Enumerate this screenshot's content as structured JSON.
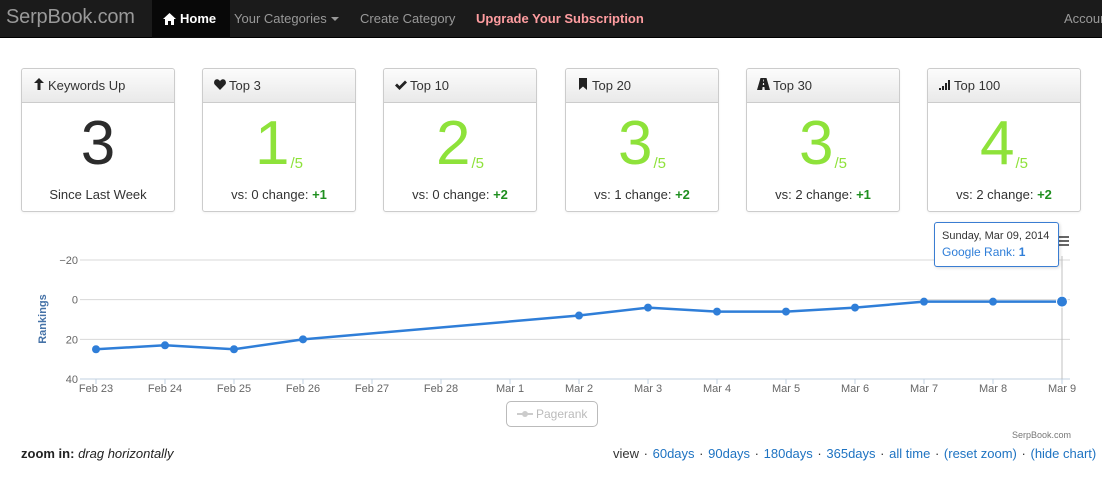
{
  "nav": {
    "brand": "SerpBook.com",
    "home": "Home",
    "categories": "Your Categories",
    "create": "Create Category",
    "upgrade": "Upgrade Your Subscription",
    "account": "Account"
  },
  "cards": [
    {
      "title": "Keywords Up",
      "icon": "arrow-up-icon",
      "value": "3",
      "denominator": "",
      "foot_text": "Since Last Week",
      "foot_change": ""
    },
    {
      "title": "Top 3",
      "icon": "heart-icon",
      "value": "1",
      "denominator": "/5",
      "foot_text": "vs: 0 change: ",
      "foot_change": "+1"
    },
    {
      "title": "Top 10",
      "icon": "check-icon",
      "value": "2",
      "denominator": "/5",
      "foot_text": "vs: 0 change: ",
      "foot_change": "+2"
    },
    {
      "title": "Top 20",
      "icon": "bookmark-icon",
      "value": "3",
      "denominator": "/5",
      "foot_text": "vs: 1 change: ",
      "foot_change": "+2"
    },
    {
      "title": "Top 30",
      "icon": "road-icon",
      "value": "3",
      "denominator": "/5",
      "foot_text": "vs: 2 change: ",
      "foot_change": "+1"
    },
    {
      "title": "Top 100",
      "icon": "signal-icon",
      "value": "4",
      "denominator": "/5",
      "foot_text": "vs: 2 change: ",
      "foot_change": "+2"
    }
  ],
  "chart_data": {
    "type": "line",
    "ylabel": "Rankings",
    "y_reversed": true,
    "ylim": [
      -20,
      40
    ],
    "yticks": [
      -20,
      0,
      20,
      40
    ],
    "categories": [
      "Feb 23",
      "Feb 24",
      "Feb 25",
      "Feb 26",
      "Feb 27",
      "Feb 28",
      "Mar 1",
      "Mar 2",
      "Mar 3",
      "Mar 4",
      "Mar 5",
      "Mar 6",
      "Mar 7",
      "Mar 8",
      "Mar 9"
    ],
    "series": [
      {
        "name": "Google Rank",
        "color": "#2f7ed8",
        "points": [
          {
            "x": "Feb 23",
            "y": 25
          },
          {
            "x": "Feb 24",
            "y": 23
          },
          {
            "x": "Feb 25",
            "y": 25
          },
          {
            "x": "Feb 26",
            "y": 20
          },
          {
            "x": "Mar 2",
            "y": 8
          },
          {
            "x": "Mar 3",
            "y": 4
          },
          {
            "x": "Mar 4",
            "y": 6
          },
          {
            "x": "Mar 5",
            "y": 6
          },
          {
            "x": "Mar 6",
            "y": 4
          },
          {
            "x": "Mar 7",
            "y": 1
          },
          {
            "x": "Mar 8",
            "y": 1
          },
          {
            "x": "Mar 9",
            "y": 1
          }
        ]
      },
      {
        "name": "Pagerank",
        "color": "#cccccc",
        "hidden": true,
        "points": []
      }
    ],
    "tooltip": {
      "date": "Sunday, Mar 09, 2014",
      "label": "Google Rank: ",
      "value": "1"
    },
    "credit": "SerpBook.com"
  },
  "footer": {
    "zoom_label": "zoom in:",
    "zoom_hint": "drag horizontally",
    "view_label": "view",
    "links": [
      "60days",
      "90days",
      "180days",
      "365days",
      "all time",
      "(reset zoom)",
      "(hide chart)"
    ]
  }
}
